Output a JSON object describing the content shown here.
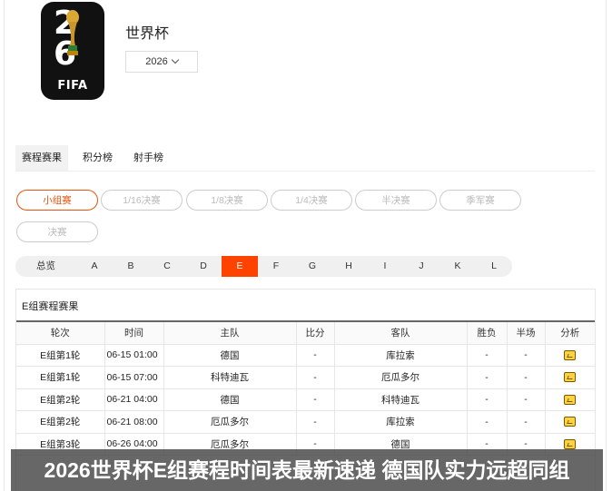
{
  "header": {
    "logo_text": "FIFA",
    "logo_digits": [
      "2",
      "6"
    ],
    "title": "世界杯",
    "year": "2026"
  },
  "tabs": [
    {
      "label": "赛程赛果",
      "active": true
    },
    {
      "label": "积分榜",
      "active": false
    },
    {
      "label": "射手榜",
      "active": false
    }
  ],
  "stages": [
    "小组赛",
    "1/16决赛",
    "1/8决赛",
    "1/4决赛",
    "半决赛",
    "季军赛",
    "决赛"
  ],
  "active_stage": "小组赛",
  "groups": [
    "总览",
    "A",
    "B",
    "C",
    "D",
    "E",
    "F",
    "G",
    "H",
    "I",
    "J",
    "K",
    "L"
  ],
  "active_group": "E",
  "table": {
    "title": "E组赛程赛果",
    "headers": [
      "轮次",
      "时间",
      "主队",
      "比分",
      "客队",
      "胜负",
      "半场",
      "分析"
    ],
    "rows": [
      {
        "round": "E组第1轮",
        "time": "06-15 01:00",
        "home": "德国",
        "score": "-",
        "away": "库拉索",
        "result": "-",
        "half": "-"
      },
      {
        "round": "E组第1轮",
        "time": "06-15 07:00",
        "home": "科特迪瓦",
        "score": "-",
        "away": "厄瓜多尔",
        "result": "-",
        "half": "-"
      },
      {
        "round": "E组第2轮",
        "time": "06-21 04:00",
        "home": "德国",
        "score": "-",
        "away": "科特迪瓦",
        "result": "-",
        "half": "-"
      },
      {
        "round": "E组第2轮",
        "time": "06-21 08:00",
        "home": "厄瓜多尔",
        "score": "-",
        "away": "库拉索",
        "result": "-",
        "half": "-"
      },
      {
        "round": "E组第3轮",
        "time": "06-26 04:00",
        "home": "厄瓜多尔",
        "score": "-",
        "away": "德国",
        "result": "-",
        "half": "-"
      }
    ]
  },
  "caption": "2026世界杯E组赛程时间表最新速递 德国队实力远超同组",
  "colors": {
    "accent": "#ff4200",
    "pill_active": "#e8540e"
  },
  "icons": {
    "analysis": "analysis-icon"
  }
}
